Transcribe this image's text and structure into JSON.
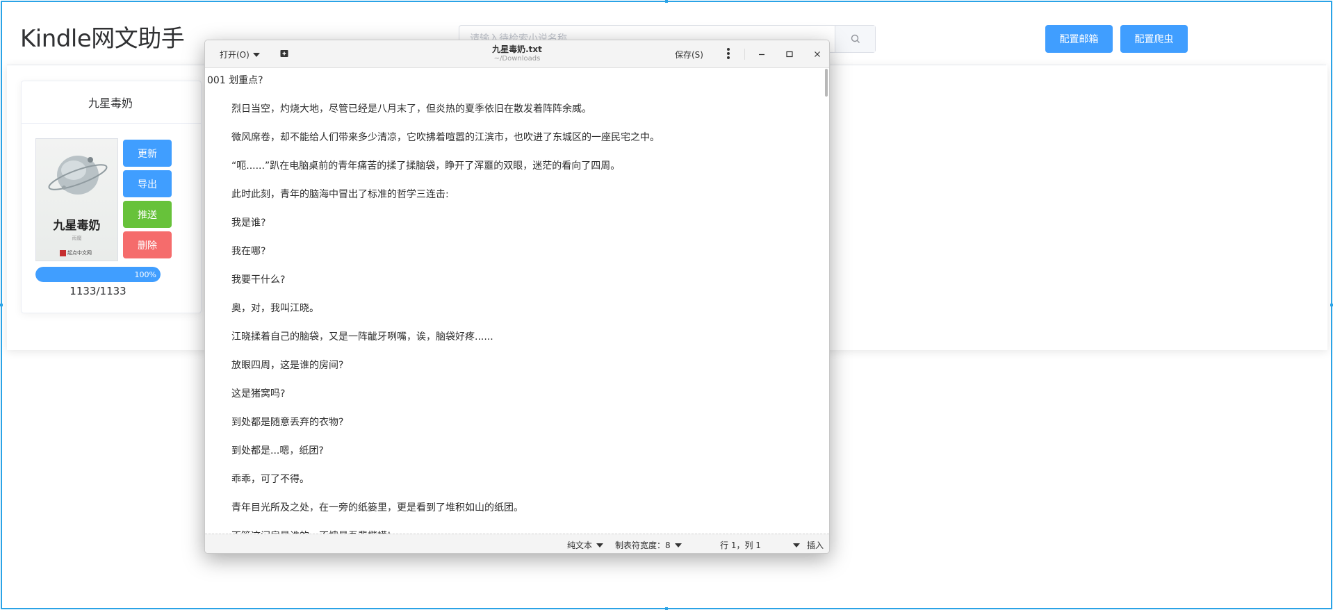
{
  "app": {
    "title": "Kindle网文助手",
    "search_placeholder": "请输入待检索小说名称",
    "config_email_label": "配置邮箱",
    "config_crawler_label": "配置爬虫"
  },
  "book": {
    "title": "九星毒奶",
    "cover_title": "九星毒奶",
    "cover_author": "雨魔",
    "cover_publisher": "起点中文网",
    "buttons": {
      "update": "更新",
      "export": "导出",
      "push": "推送",
      "delete": "删除"
    },
    "progress_text": "100%",
    "progress_value": 1.0,
    "count": "1133/1133"
  },
  "editor": {
    "open_label": "打开(O)",
    "filename": "九星毒奶.txt",
    "path": "~/Downloads",
    "save_label": "保存(S)",
    "lines": [
      "001  划重点?",
      "烈日当空，灼烧大地，尽管已经是八月末了，但炎热的夏季依旧在散发着阵阵余威。",
      "微风席卷，却不能给人们带来多少清凉，它吹拂着喧嚣的江滨市，也吹进了东城区的一座民宅之中。",
      "“呃......”趴在电脑桌前的青年痛苦的揉了揉脑袋，睁开了浑噩的双眼，迷茫的看向了四周。",
      "此时此刻，青年的脑海中冒出了标准的哲学三连击:",
      "我是谁?",
      "我在哪?",
      "我要干什么?",
      "奥，对，我叫江晓。",
      "江晓揉着自己的脑袋，又是一阵龇牙咧嘴，诶，脑袋好疼......",
      "放眼四周，这是谁的房间?",
      "这是猪窝吗?",
      "到处都是随意丢弃的衣物?",
      "到处都是...嗯，纸团?",
      "乖乖，可了不得。",
      "青年目光所及之处，在一旁的纸篓里，更是看到了堆积如山的纸团。",
      "不管这间房是谁的，不愧是吾辈楷模!"
    ],
    "status": {
      "syntax": "纯文本",
      "tab_width": "制表符宽度：8",
      "position": "行 1，列 1",
      "mode": "插入"
    }
  },
  "colors": {
    "primary": "#409eff",
    "success": "#67c23a",
    "danger": "#f56c6c",
    "frame": "#2aa3e6"
  }
}
